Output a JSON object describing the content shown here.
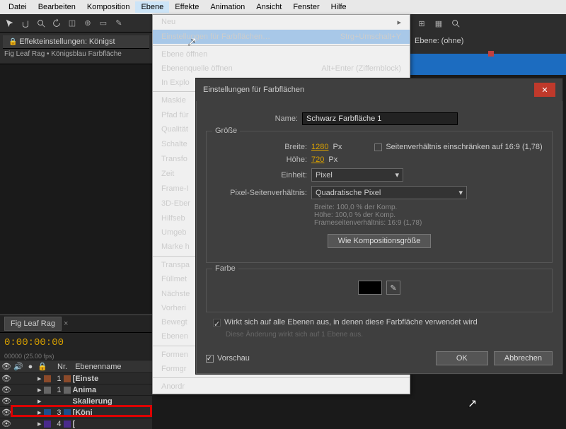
{
  "menubar": {
    "items": [
      "Datei",
      "Bearbeiten",
      "Komposition",
      "Ebene",
      "Effekte",
      "Animation",
      "Ansicht",
      "Fenster",
      "Hilfe"
    ],
    "active": 3
  },
  "effect_panel": {
    "icon_label": "Effekteinstellungen:",
    "title": "Königst",
    "path": "Fig Leaf Rag • Königsblau Farbfläche"
  },
  "right_effect": {
    "label": "Ebene:",
    "value": "(ohne)"
  },
  "dropdown": {
    "items": [
      {
        "label": "Neu",
        "type": "sub"
      },
      {
        "label": "Einstellungen für Farbflächen…",
        "shortcut": "Strg+Umschalt+Y",
        "type": "sel"
      },
      {
        "sep": true
      },
      {
        "label": "Ebene öffnen"
      },
      {
        "label": "Ebenenquelle öffnen",
        "shortcut": "Alt+Enter (Ziffernblock)"
      },
      {
        "label": "In Explo",
        "type": "dis"
      },
      {
        "sep": true
      },
      {
        "label": "Maskie",
        "type": "sub"
      },
      {
        "label": "Pfad für"
      },
      {
        "label": "Qualität",
        "type": "sub"
      },
      {
        "label": "Schalte",
        "type": "sub"
      },
      {
        "label": "Transfo",
        "type": "sub"
      },
      {
        "label": "Zeit",
        "type": "sub"
      },
      {
        "label": "Frame-I",
        "type": "sub"
      },
      {
        "label": "3D-Eber",
        "type": "sub"
      },
      {
        "label": "Hilfseb"
      },
      {
        "label": "Umgeb"
      },
      {
        "label": "Marke h",
        "type": "sub"
      },
      {
        "sep": true
      },
      {
        "label": "Transpa"
      },
      {
        "label": "Füllmet",
        "type": "sub"
      },
      {
        "label": "Nächste"
      },
      {
        "label": "Vorheri"
      },
      {
        "label": "Bewegt"
      },
      {
        "label": "Ebenen",
        "type": "sub"
      },
      {
        "sep": true
      },
      {
        "label": "Formen"
      },
      {
        "label": "Formgr"
      },
      {
        "sep": true
      },
      {
        "label": "Anordr"
      }
    ]
  },
  "dialog": {
    "title": "Einstellungen für Farbflächen",
    "name_label": "Name:",
    "name_value": "Schwarz Farbfläche 1",
    "size_legend": "Größe",
    "width_label": "Breite:",
    "width_value": "1280",
    "width_unit": "Px",
    "height_label": "Höhe:",
    "height_value": "720",
    "height_unit": "Px",
    "aspect_lock": "Seitenverhältnis einschränken auf 16:9 (1,78)",
    "unit_label": "Einheit:",
    "unit_value": "Pixel",
    "par_label": "Pixel-Seitenverhältnis:",
    "par_value": "Quadratische Pixel",
    "info1": "Breite:   100,0 % der Komp.",
    "info2": "Höhe:   100,0 % der Komp.",
    "info3": "Frameseitenverhältnis:   16:9 (1,78)",
    "comp_size_btn": "Wie Kompositionsgröße",
    "color_legend": "Farbe",
    "affect_all": "Wirkt sich auf alle Ebenen aus, in denen diese Farbfläche verwendet wird",
    "affect_note": "Diese Änderung wirkt sich auf 1 Ebene aus.",
    "preview_label": "Vorschau",
    "ok": "OK",
    "cancel": "Abbrechen"
  },
  "timeline": {
    "tab": "Fig Leaf Rag",
    "timecode": "0:00:00:00",
    "timecode_sub": "00000 (25.00 fps)",
    "hdr_nr": "Nr.",
    "hdr_name": "Ebenenname",
    "rows": [
      {
        "n": "1",
        "name": "[Einste",
        "c": "#8b4a2a"
      },
      {
        "n": "1",
        "name": "Anima",
        "c": "#666"
      },
      {
        "n": "",
        "name": "Skalierung",
        "c": ""
      },
      {
        "n": "3",
        "name": "[Köni",
        "c": "#1c4e8c"
      },
      {
        "n": "4",
        "name": "[",
        "c": "#4a2a8b"
      }
    ]
  }
}
